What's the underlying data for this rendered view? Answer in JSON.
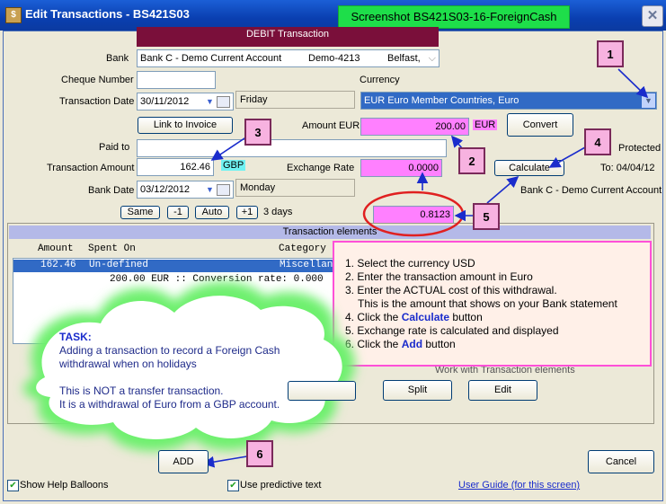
{
  "window": {
    "title": "Edit Transactions - BS421S03",
    "icon_glyph": "$",
    "screenshot_label": "Screenshot BS421S03-16-ForeignCash",
    "close_glyph": "✕"
  },
  "header_bar": "DEBIT Transaction",
  "form": {
    "bank_label": "Bank",
    "bank_name": "Bank C - Demo Current Account",
    "bank_code": "Demo-4213",
    "bank_branch": "Belfast,",
    "cheque_label": "Cheque Number",
    "cheque_value": "",
    "currency_label": "Currency",
    "currency_value": "EUR Euro Member Countries, Euro",
    "tdate_label": "Transaction Date",
    "tdate_value": "30/11/2012",
    "tdate_day": "Friday",
    "link_invoice": "Link to Invoice",
    "amount_eur_label": "Amount EUR",
    "amount_eur_value": "200.00",
    "amount_eur_unit": "EUR",
    "convert_button": "Convert",
    "paid_to_label": "Paid to",
    "paid_to_value": "",
    "protected_label": "Protected",
    "tamount_label": "Transaction Amount",
    "tamount_value": "162.46",
    "tamount_unit": "GBP",
    "xrate_label": "Exchange Rate",
    "xrate_value": "0.0000",
    "calculate_button": "Calculate",
    "to_date": "To: 04/04/12",
    "bdate_label": "Bank Date",
    "bdate_value": "03/12/2012",
    "bdate_day": "Monday",
    "bank_account_info": "Bank C - Demo Current Account",
    "same_button": "Same",
    "minus_button": "-1",
    "auto_button": "Auto",
    "plus_button": "+1",
    "days_text": "3 days",
    "calc_rate_value": "0.8123"
  },
  "elements": {
    "title": "Transaction elements",
    "col_amount": "Amount",
    "col_spent": "Spent On",
    "col_category": "Category",
    "row_amount": "162.46",
    "row_spent": "Un-defined",
    "row_category": "Miscellan",
    "sub_row": "200.00 EUR :: Conversion rate: 0.000",
    "work_label": "Work with Transaction elements",
    "split_button": "Split",
    "edit_button": "Edit"
  },
  "help": {
    "steps": [
      "1. Select the currency USD",
      "2. Enter the transaction amount in Euro",
      "3. Enter the ACTUAL cost of this withdrawal.",
      "This is the amount that shows on your Bank statement",
      "4. Click the ",
      "Calculate",
      " button",
      "5. Exchange rate is calculated and displayed",
      "6. Click the ",
      "Add",
      " button"
    ]
  },
  "task": {
    "title": "TASK:",
    "line1": "Adding a transaction to record a Foreign Cash",
    "line2": "withdrawal when on holidays",
    "line3": "This is NOT a transfer transaction.",
    "line4": "It is a withdrawal of Euro from a GBP account."
  },
  "callouts": [
    "1",
    "2",
    "3",
    "4",
    "5",
    "6"
  ],
  "footer": {
    "add_button": "ADD",
    "cancel_button": "Cancel",
    "show_help": "Show Help Balloons",
    "predictive": "Use predictive text",
    "user_guide": "User Guide (for this screen)"
  },
  "colors": {
    "title_bar": "#0a3fb0",
    "pink_field": "#ff80ff",
    "header_bar": "#7a0f3a",
    "selection": "#316ac5",
    "callout": "#f7b2e0",
    "arrow": "#1a2ccc",
    "highlight_ellipse": "#e02020",
    "label_green": "#1ede4a"
  }
}
